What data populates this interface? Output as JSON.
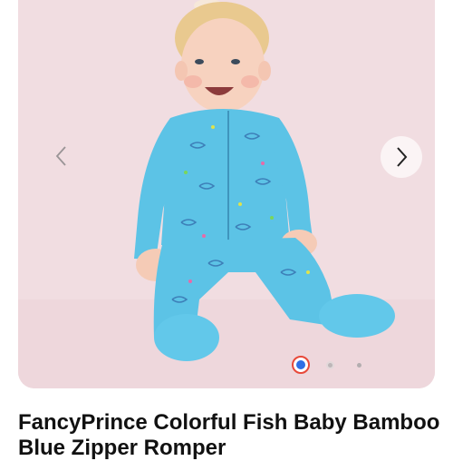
{
  "gallery": {
    "image_count": 3,
    "active_index": 1,
    "prev_icon": "chevron-left-icon",
    "next_icon": "chevron-right-icon",
    "colors": {
      "background": "#f1dde1",
      "active_dot_ring": "#e8493a",
      "active_dot_fill": "#2f6fe6",
      "romper": "#5cc3e6"
    }
  },
  "product": {
    "title": "FancyPrince Colorful Fish Baby Bamboo Blue Zipper Romper"
  }
}
